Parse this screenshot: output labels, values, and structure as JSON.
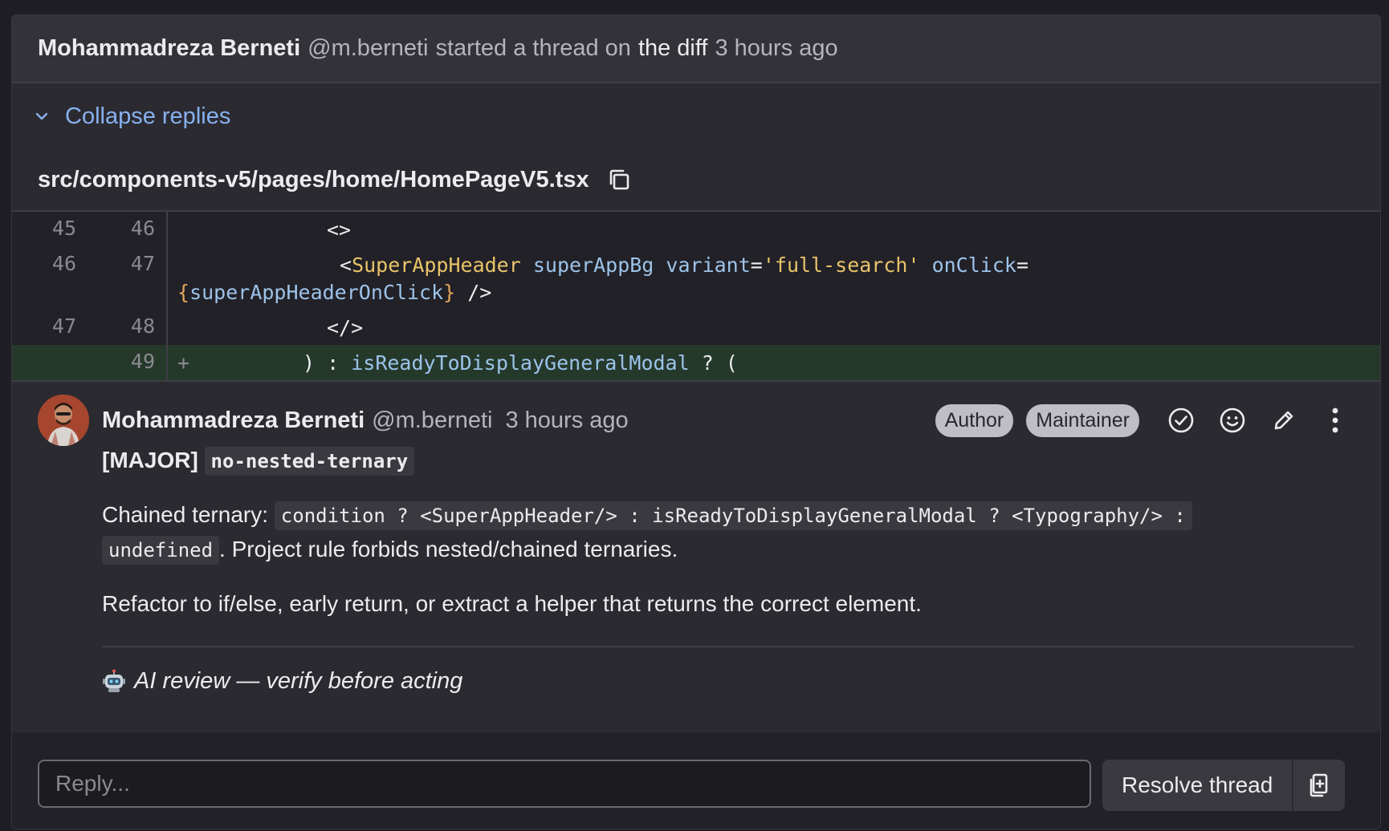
{
  "thread": {
    "author": "Mohammadreza Berneti",
    "handle": "@m.berneti",
    "action": "started a thread on",
    "target": "the diff",
    "time": "3 hours ago"
  },
  "collapse_label": "Collapse replies",
  "file": {
    "path": "src/components-v5/pages/home/HomePageV5.tsx",
    "copy_icon": "copy-icon"
  },
  "diff": {
    "rows": [
      {
        "old": "45",
        "new": "46"
      },
      {
        "old": "46",
        "new": "47"
      },
      {
        "old": "47",
        "new": "48"
      },
      {
        "old": "",
        "new": "49",
        "marker": "+"
      }
    ]
  },
  "code": {
    "l1": "<>",
    "l2_open": "<",
    "l2_tag": "SuperAppHeader",
    "l2_attr1": "superAppBg",
    "l2_attr2": "variant",
    "l2_eq": "=",
    "l2_str": "'full-search'",
    "l2_attr3": "onClick",
    "l2_eq2": "=",
    "l2_brace_open": "{",
    "l2_expr": "superAppHeaderOnClick",
    "l2_brace_close": "}",
    "l2_close": " />",
    "l3": "</>",
    "l4_pre": ") : ",
    "l4_id": "isReadyToDisplayGeneralModal",
    "l4_post": " ? ("
  },
  "note": {
    "author": "Mohammadreza Berneti",
    "handle": "@m.berneti",
    "time": "3 hours ago",
    "badges": [
      "Author",
      "Maintainer"
    ],
    "severity": "[MAJOR]",
    "rule": "no-nested-ternary",
    "p1_prefix": "Chained ternary:",
    "p1_code": "condition ? <SuperAppHeader/> : isReadyToDisplayGeneralModal ? <Typography/> :",
    "p1_code2": "undefined",
    "p1_suffix": ". Project rule forbids nested/chained ternaries.",
    "p2": "Refactor to if/else, early return, or extract a helper that returns the correct element.",
    "ai_note": "AI review — verify before acting"
  },
  "reply": {
    "placeholder": "Reply...",
    "resolve_label": "Resolve thread"
  },
  "colors": {
    "link": "#87b1ee",
    "added_bg": "#25392b",
    "badge_bg": "#bfbec5"
  }
}
